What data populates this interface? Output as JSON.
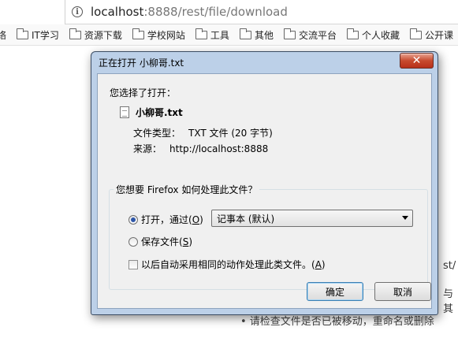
{
  "browser": {
    "url_host": "localhost",
    "url_rest": ":8888/rest/file/download",
    "bookmarks": [
      {
        "label": "络",
        "folder": false
      },
      {
        "label": "IT学习",
        "folder": true
      },
      {
        "label": "资源下载",
        "folder": true
      },
      {
        "label": "学校网站",
        "folder": true
      },
      {
        "label": "工具",
        "folder": true
      },
      {
        "label": "其他",
        "folder": true
      },
      {
        "label": "交流平台",
        "folder": true
      },
      {
        "label": "个人收藏",
        "folder": true
      },
      {
        "label": "公开课",
        "folder": true
      }
    ]
  },
  "background": {
    "text1": "st/",
    "text2": "与其",
    "text3": "• 请检查文件是否已被移动，重命名或删除"
  },
  "dialog": {
    "title": "正在打开 小柳哥.txt",
    "close_symbol": "✕",
    "prompt": "您选择了打开：",
    "file_name": "小柳哥.txt",
    "type_label": "文件类型：",
    "type_value": "TXT 文件 (20 字节)",
    "source_label": "来源：",
    "source_value": "http://localhost:8888",
    "question": "您想要 Firefox 如何处理此文件？",
    "open_with_label": "打开，通过(",
    "open_with_key": "O",
    "open_with_close": ")",
    "open_with_app": "记事本 (默认)",
    "save_label": "保存文件(",
    "save_key": "S",
    "save_close": ")",
    "auto_label": "以后自动采用相同的动作处理此类文件。(",
    "auto_key": "A",
    "auto_close": ")",
    "ok_label": "确定",
    "cancel_label": "取消",
    "open_with_selected": true,
    "remember_checked": false
  }
}
